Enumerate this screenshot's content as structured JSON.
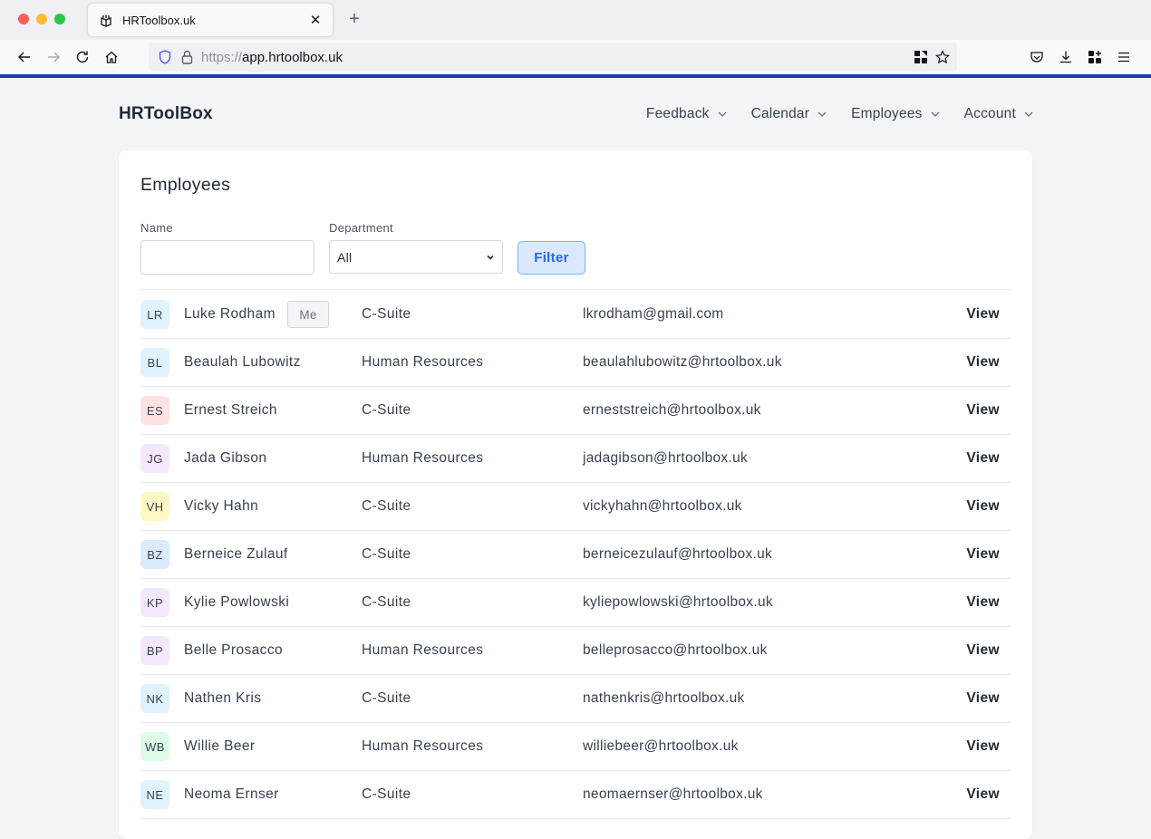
{
  "browser": {
    "tab_title": "HRToolbox.uk",
    "url_scheme": "https://",
    "url_host": "app.hrtoolbox.uk",
    "accent_line_color": "#1f3fa8"
  },
  "header": {
    "brand": "HRToolBox",
    "nav": [
      {
        "label": "Feedback"
      },
      {
        "label": "Calendar"
      },
      {
        "label": "Employees"
      },
      {
        "label": "Account"
      }
    ]
  },
  "page": {
    "title": "Employees",
    "filters": {
      "name_label": "Name",
      "name_value": "",
      "name_placeholder": "",
      "department_label": "Department",
      "department_selected": "All",
      "filter_button": "Filter"
    },
    "me_badge": "Me",
    "view_label": "View",
    "employees": [
      {
        "initials": "LR",
        "name": "Luke Rodham",
        "department": "C-Suite",
        "email": "lkrodham@gmail.com",
        "is_me": true,
        "avatar_color": "#e0f2fe"
      },
      {
        "initials": "BL",
        "name": "Beaulah Lubowitz",
        "department": "Human Resources",
        "email": "beaulahlubowitz@hrtoolbox.uk",
        "is_me": false,
        "avatar_color": "#e0f2fe"
      },
      {
        "initials": "ES",
        "name": "Ernest Streich",
        "department": "C-Suite",
        "email": "erneststreich@hrtoolbox.uk",
        "is_me": false,
        "avatar_color": "#fee2e2"
      },
      {
        "initials": "JG",
        "name": "Jada Gibson",
        "department": "Human Resources",
        "email": "jadagibson@hrtoolbox.uk",
        "is_me": false,
        "avatar_color": "#f3e8ff"
      },
      {
        "initials": "VH",
        "name": "Vicky Hahn",
        "department": "C-Suite",
        "email": "vickyhahn@hrtoolbox.uk",
        "is_me": false,
        "avatar_color": "#fef9c3"
      },
      {
        "initials": "BZ",
        "name": "Berneice Zulauf",
        "department": "C-Suite",
        "email": "berneicezulauf@hrtoolbox.uk",
        "is_me": false,
        "avatar_color": "#dbeafe"
      },
      {
        "initials": "KP",
        "name": "Kylie Powlowski",
        "department": "C-Suite",
        "email": "kyliepowlowski@hrtoolbox.uk",
        "is_me": false,
        "avatar_color": "#f3e8ff"
      },
      {
        "initials": "BP",
        "name": "Belle Prosacco",
        "department": "Human Resources",
        "email": "belleprosacco@hrtoolbox.uk",
        "is_me": false,
        "avatar_color": "#f3e8ff"
      },
      {
        "initials": "NK",
        "name": "Nathen Kris",
        "department": "C-Suite",
        "email": "nathenkris@hrtoolbox.uk",
        "is_me": false,
        "avatar_color": "#e0f2fe"
      },
      {
        "initials": "WB",
        "name": "Willie Beer",
        "department": "Human Resources",
        "email": "williebeer@hrtoolbox.uk",
        "is_me": false,
        "avatar_color": "#dcfce7"
      },
      {
        "initials": "NE",
        "name": "Neoma Ernser",
        "department": "C-Suite",
        "email": "neomaernser@hrtoolbox.uk",
        "is_me": false,
        "avatar_color": "#e0f2fe"
      }
    ]
  }
}
